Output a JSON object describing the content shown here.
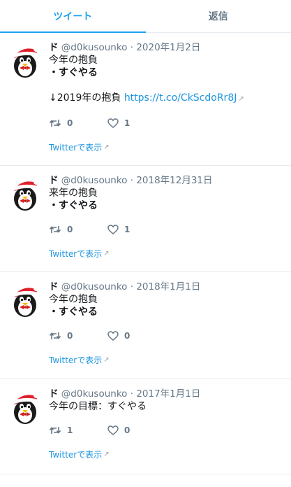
{
  "tabs": [
    {
      "label": "ツイート",
      "active": true
    },
    {
      "label": "返信",
      "active": false
    }
  ],
  "colors": {
    "accent": "#1da1f2",
    "link": "#1b95e0",
    "muted": "#657786",
    "divider": "#e6ecf0"
  },
  "icons": {
    "retweet": "retweet-icon",
    "like": "heart-icon",
    "external": "external-link-icon"
  },
  "tweets": [
    {
      "name": "ド",
      "handle": "@d0kusounko",
      "separator": "·",
      "date": "2020年1月2日",
      "lines": [
        "今年の抱負",
        "・すぐやる",
        "",
        "↓2019年の抱負"
      ],
      "link": "https://t.co/CkScdoRr8J",
      "retweets": "0",
      "likes": "1",
      "view": "Twitterで表示"
    },
    {
      "name": "ド",
      "handle": "@d0kusounko",
      "separator": "·",
      "date": "2018年12月31日",
      "lines": [
        "来年の抱負",
        "・すぐやる"
      ],
      "retweets": "0",
      "likes": "1",
      "view": "Twitterで表示"
    },
    {
      "name": "ド",
      "handle": "@d0kusounko",
      "separator": "·",
      "date": "2018年1月1日",
      "lines": [
        "今年の抱負",
        "・すぐやる"
      ],
      "retweets": "0",
      "likes": "0",
      "view": "Twitterで表示"
    },
    {
      "name": "ド",
      "handle": "@d0kusounko",
      "separator": "·",
      "date": "2017年1月1日",
      "lines": [
        "今年の目標：すぐやる"
      ],
      "retweets": "1",
      "likes": "0",
      "view": "Twitterで表示"
    }
  ]
}
